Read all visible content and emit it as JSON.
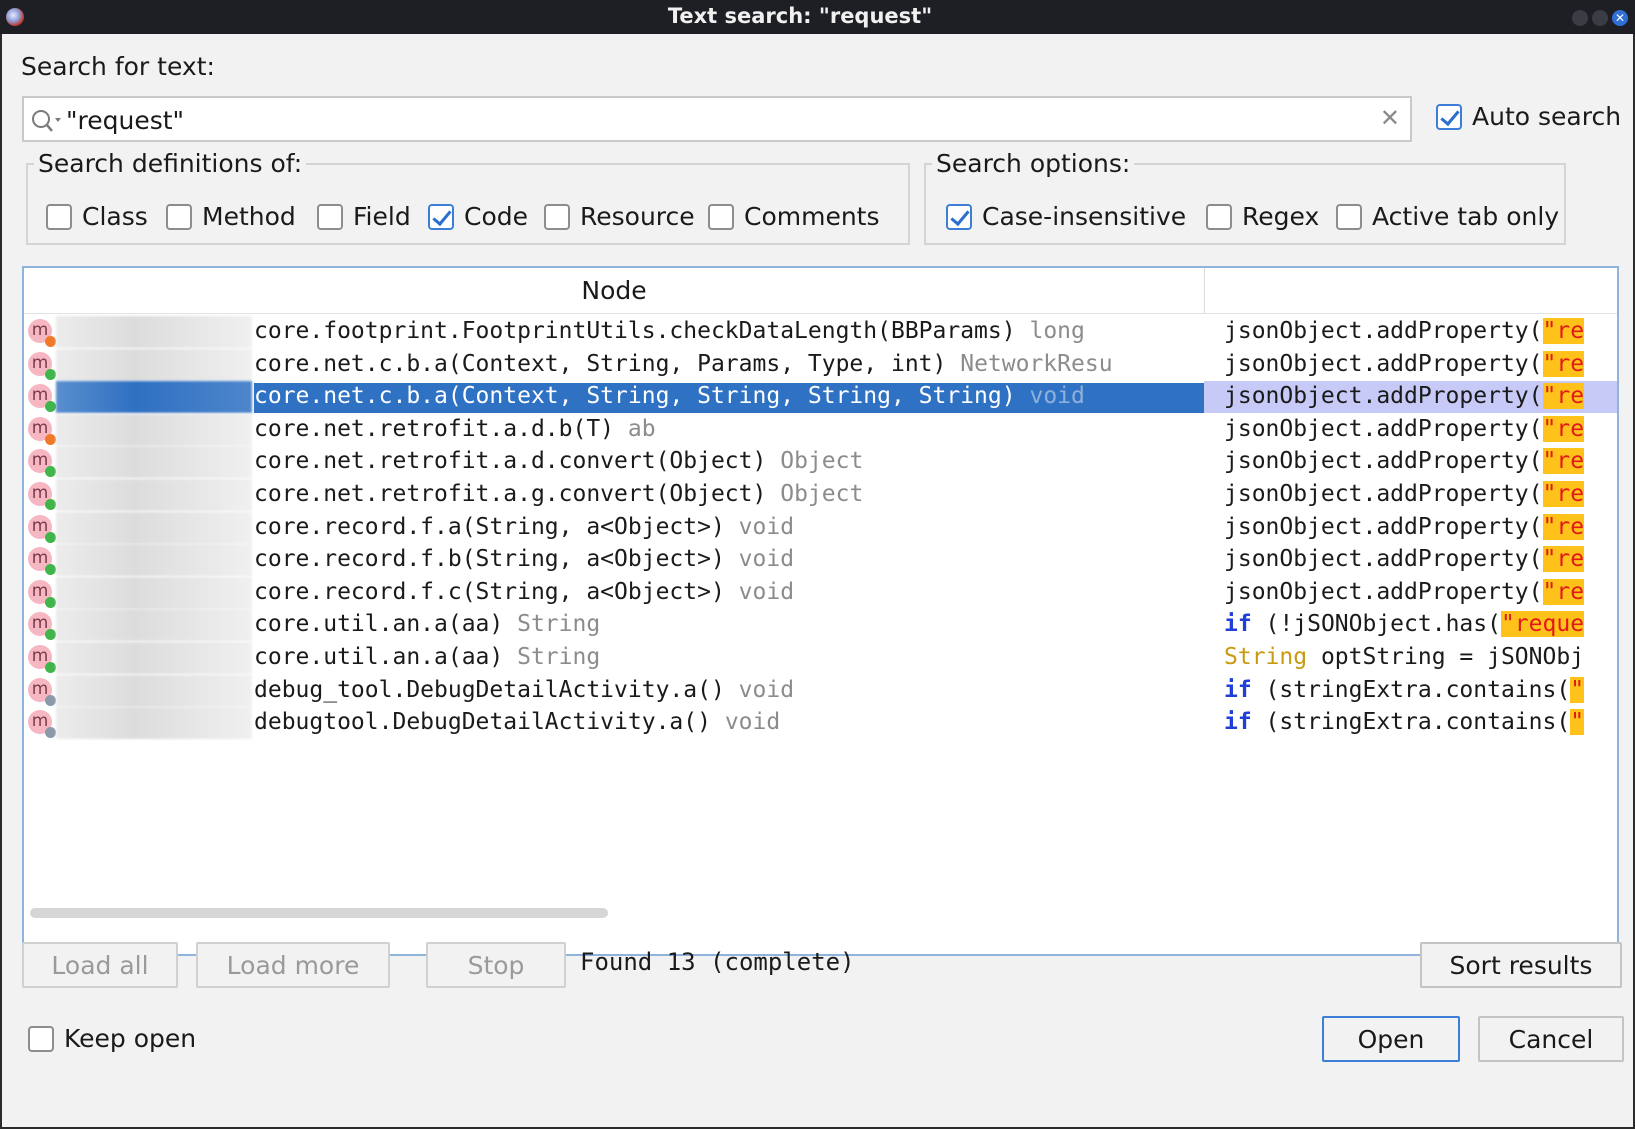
{
  "window": {
    "title": "Text search: \"request\""
  },
  "search": {
    "label": "Search for text:",
    "value": "\"request\"",
    "auto_search_label": "Auto search",
    "auto_search_checked": true
  },
  "definitions": {
    "legend": "Search definitions of:",
    "items": [
      {
        "label": "Class",
        "checked": false
      },
      {
        "label": "Method",
        "checked": false
      },
      {
        "label": "Field",
        "checked": false
      },
      {
        "label": "Code",
        "checked": true
      },
      {
        "label": "Resource",
        "checked": false
      },
      {
        "label": "Comments",
        "checked": false
      }
    ]
  },
  "options": {
    "legend": "Search options:",
    "items": [
      {
        "label": "Case-insensitive",
        "checked": true
      },
      {
        "label": "Regex",
        "checked": false
      },
      {
        "label": "Active tab only",
        "checked": false
      }
    ]
  },
  "table": {
    "header_node": "Node",
    "rows": [
      {
        "icon": "m",
        "dot": "orange",
        "node": "core.footprint.FootprintUtils.checkDataLength(BBParams)",
        "ret": "long",
        "code": [
          [
            "",
            "jsonObject.addProperty("
          ],
          [
            "hl",
            "\"re"
          ]
        ]
      },
      {
        "icon": "m",
        "dot": "green",
        "node": "core.net.c.b.a(Context, String, Params, Type, int)",
        "ret": "NetworkResu",
        "code": [
          [
            "",
            "jsonObject.addProperty("
          ],
          [
            "hl",
            "\"re"
          ]
        ]
      },
      {
        "icon": "m",
        "dot": "green",
        "node": "core.net.c.b.a(Context, String, String, String, String)",
        "ret": "void",
        "code": [
          [
            "",
            "jsonObject.addProperty("
          ],
          [
            "hl",
            "\"re"
          ]
        ],
        "selected": true
      },
      {
        "icon": "m",
        "dot": "orange",
        "node": "core.net.retrofit.a.d.b(T)",
        "ret": "ab",
        "code": [
          [
            "",
            "jsonObject.addProperty("
          ],
          [
            "hl",
            "\"re"
          ]
        ]
      },
      {
        "icon": "m",
        "dot": "green",
        "node": "core.net.retrofit.a.d.convert(Object)",
        "ret": "Object",
        "code": [
          [
            "",
            "jsonObject.addProperty("
          ],
          [
            "hl",
            "\"re"
          ]
        ]
      },
      {
        "icon": "m",
        "dot": "green",
        "node": "core.net.retrofit.a.g.convert(Object)",
        "ret": "Object",
        "code": [
          [
            "",
            "jsonObject.addProperty("
          ],
          [
            "hl",
            "\"re"
          ]
        ]
      },
      {
        "icon": "m",
        "dot": "green",
        "node": "core.record.f.a(String, a<Object>)",
        "ret": "void",
        "code": [
          [
            "",
            "jsonObject.addProperty("
          ],
          [
            "hl",
            "\"re"
          ]
        ]
      },
      {
        "icon": "m",
        "dot": "green",
        "node": "core.record.f.b(String, a<Object>)",
        "ret": "void",
        "code": [
          [
            "",
            "jsonObject.addProperty("
          ],
          [
            "hl",
            "\"re"
          ]
        ]
      },
      {
        "icon": "m",
        "dot": "green",
        "node": "core.record.f.c(String, a<Object>)",
        "ret": "void",
        "code": [
          [
            "",
            "jsonObject.addProperty("
          ],
          [
            "hl",
            "\"re"
          ]
        ]
      },
      {
        "icon": "m",
        "dot": "green",
        "node": "core.util.an.a(aa)",
        "ret": "String",
        "code": [
          [
            "kw",
            "if"
          ],
          [
            "",
            " (!jSONObject.has("
          ],
          [
            "hl",
            "\"reque"
          ]
        ]
      },
      {
        "icon": "m",
        "dot": "green",
        "node": "core.util.an.a(aa)",
        "ret": "String",
        "code": [
          [
            "ty",
            "String"
          ],
          [
            "",
            " optString = jSONObj"
          ]
        ]
      },
      {
        "icon": "m",
        "dot": "grey",
        "node": "debug_tool.DebugDetailActivity.a()",
        "ret": "void",
        "code": [
          [
            "kw",
            "if"
          ],
          [
            "",
            " (stringExtra.contains("
          ],
          [
            "hl",
            "\""
          ]
        ]
      },
      {
        "icon": "m",
        "dot": "grey",
        "node": "debugtool.DebugDetailActivity.a()",
        "ret": "void",
        "code": [
          [
            "kw",
            "if"
          ],
          [
            "",
            " (stringExtra.contains("
          ],
          [
            "hl",
            "\""
          ]
        ]
      }
    ]
  },
  "buttons": {
    "load_all": "Load all",
    "load_more": "Load more",
    "stop": "Stop",
    "sort_results": "Sort results",
    "open": "Open",
    "cancel": "Cancel"
  },
  "status": "Found 13 (complete)",
  "keep_open": {
    "label": "Keep open",
    "checked": false
  },
  "colors": {
    "accent": "#2f72c4",
    "highlight": "#ffc21a",
    "keyword": "#1f3fd6"
  }
}
